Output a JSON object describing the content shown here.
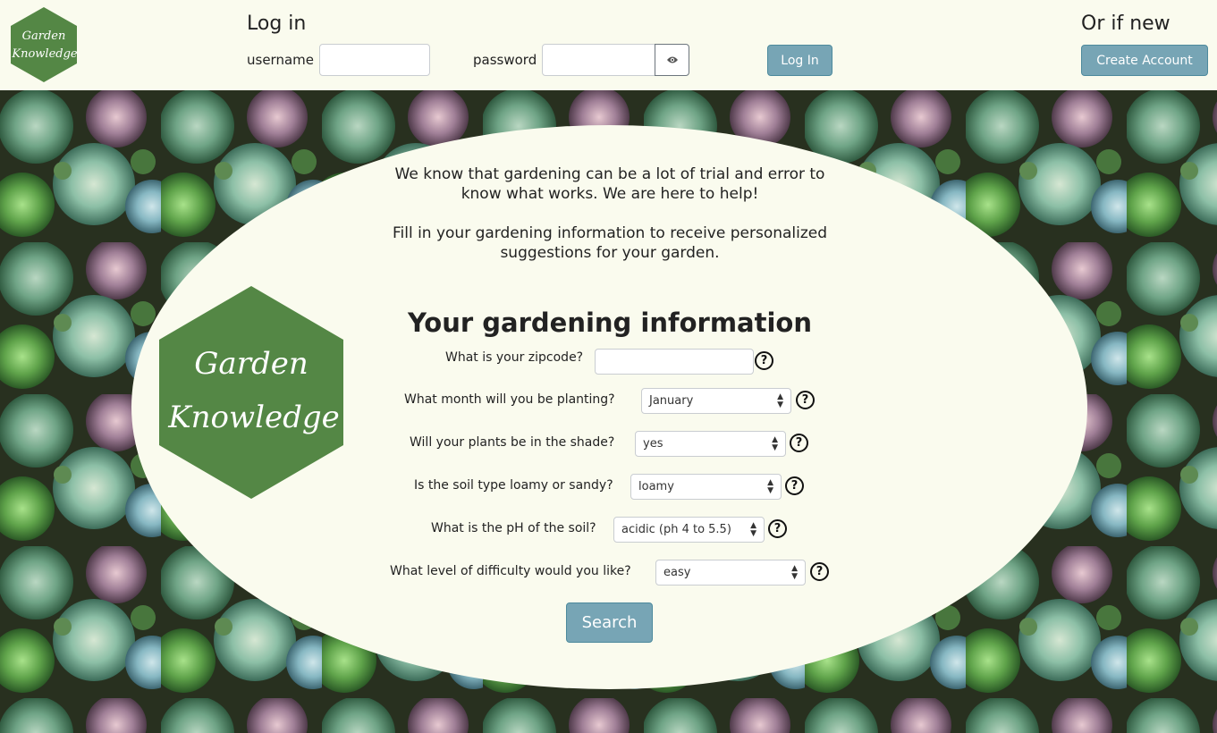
{
  "header": {
    "logo_text_line1": "Garden",
    "logo_text_line2": "Knowledge",
    "login_title": "Log in",
    "username_label": "username",
    "password_label": "password",
    "login_button": "Log In",
    "new_title": "Or if new",
    "create_account_button": "Create Account"
  },
  "intro": {
    "paragraph1": "We know that gardening can be a lot of trial and error to know what works. We are here to help!",
    "paragraph2": "Fill in your gardening information to receive personalized suggestions for your garden."
  },
  "form": {
    "title": "Your gardening information",
    "zipcode_question": "What is your zipcode?",
    "month_question": "What month will you be planting?",
    "month_value": "January",
    "shade_question": "Will your plants be in the shade?",
    "shade_value": "yes",
    "soil_question": "Is the soil type loamy or sandy?",
    "soil_value": "loamy",
    "ph_question": "What is the pH of the soil?",
    "ph_value": "acidic (ph 4 to 5.5)",
    "difficulty_question": "What level of difficulty would you like?",
    "difficulty_value": "easy",
    "help_glyph": "?",
    "search_button": "Search"
  },
  "colors": {
    "logo_green": "#548745",
    "cream": "#fafbee",
    "button_teal": "#77a5b5"
  },
  "icons": [
    "eye-icon",
    "help-icon"
  ]
}
